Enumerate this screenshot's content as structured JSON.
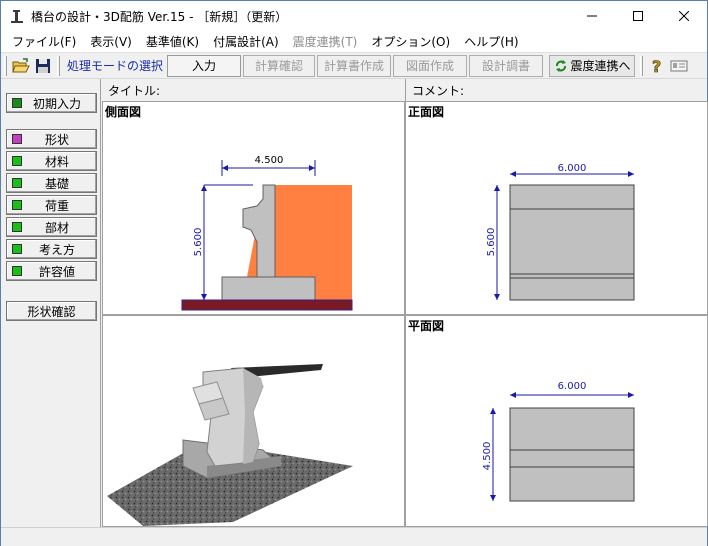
{
  "window": {
    "title": "橋台の設計・3D配筋 Ver.15 - ［新規］（更新）"
  },
  "menu": [
    {
      "label": "ファイル(F)",
      "enabled": true
    },
    {
      "label": "表示(V)",
      "enabled": true
    },
    {
      "label": "基準値(K)",
      "enabled": true
    },
    {
      "label": "付属設計(A)",
      "enabled": true
    },
    {
      "label": "震度連携(T)",
      "enabled": false
    },
    {
      "label": "オプション(O)",
      "enabled": true
    },
    {
      "label": "ヘルプ(H)",
      "enabled": true
    }
  ],
  "toolbar": {
    "mode_label": "処理モードの選択",
    "buttons": [
      {
        "label": "入力",
        "state": "active"
      },
      {
        "label": "計算確認",
        "state": "disabled"
      },
      {
        "label": "計算書作成",
        "state": "disabled"
      },
      {
        "label": "図面作成",
        "state": "disabled"
      },
      {
        "label": "設計調書",
        "state": "disabled"
      }
    ],
    "quake_link": "震度連携へ"
  },
  "sidebar": {
    "initial_input": "初期入力",
    "items": [
      {
        "label": "形状",
        "color": "#c040c0"
      },
      {
        "label": "材料",
        "color": "#18c018"
      },
      {
        "label": "基礎",
        "color": "#18c018"
      },
      {
        "label": "荷重",
        "color": "#18c018"
      },
      {
        "label": "部材",
        "color": "#18c018"
      },
      {
        "label": "考え方",
        "color": "#18c018"
      },
      {
        "label": "許容値",
        "color": "#18c018"
      }
    ],
    "shape_check": "形状確認"
  },
  "header": {
    "title_label": "タイトル:",
    "comment_label": "コメント:"
  },
  "panes": {
    "side": {
      "title": "側面図",
      "width_dim": "4.500",
      "height_dim": "5.600"
    },
    "front": {
      "title": "正面図",
      "width_dim": "6.000",
      "height_dim": "5.600"
    },
    "plan": {
      "title": "平面図",
      "width_dim": "6.000",
      "height_dim": "4.500"
    }
  }
}
